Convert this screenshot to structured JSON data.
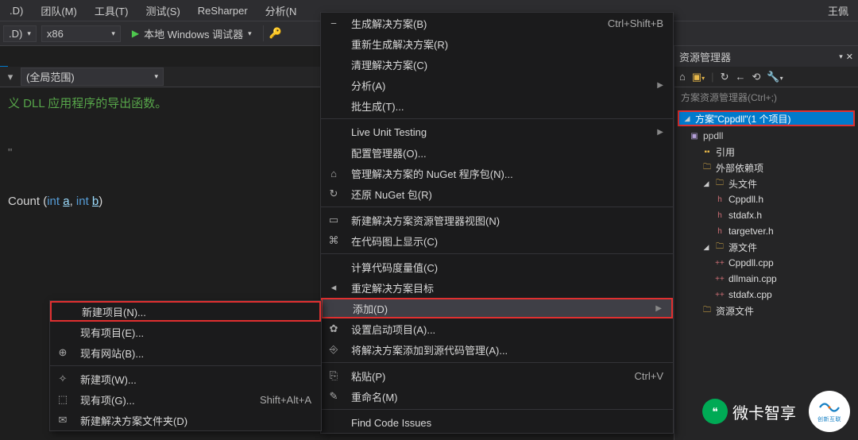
{
  "menubar": {
    "items": [
      ".D)",
      "团队(M)",
      "工具(T)",
      "测试(S)",
      "ReSharper",
      "分析(N"
    ],
    "user": "王佩"
  },
  "toolbar": {
    "platform": ".D)",
    "arch": "x86",
    "debugger": "本地 Windows 调试器"
  },
  "scope": {
    "label": "(全局范围)"
  },
  "code": {
    "comment": "义 DLL 应用程序的导出函数。",
    "quote": "\"",
    "func": {
      "name": "Count",
      "type": "int",
      "p1": "a",
      "p2": "b"
    }
  },
  "mainmenu": {
    "items": [
      {
        "ico": "⎯",
        "t": "生成解决方案(B)",
        "sc": "Ctrl+Shift+B"
      },
      {
        "ico": "",
        "t": "重新生成解决方案(R)",
        "sc": ""
      },
      {
        "ico": "",
        "t": "清理解决方案(C)",
        "sc": ""
      },
      {
        "ico": "",
        "t": "分析(A)",
        "sub": true,
        "sc": ""
      },
      {
        "ico": "",
        "t": "批生成(T)...",
        "sc": ""
      },
      {
        "sep": true
      },
      {
        "ico": "",
        "t": "Live Unit Testing",
        "sub": true,
        "sc": ""
      },
      {
        "ico": "",
        "t": "配置管理器(O)...",
        "sc": ""
      },
      {
        "ico": "⌂",
        "t": "管理解决方案的 NuGet 程序包(N)...",
        "sc": ""
      },
      {
        "ico": "↻",
        "t": "还原 NuGet 包(R)",
        "sc": ""
      },
      {
        "sep": true
      },
      {
        "ico": "▭",
        "t": "新建解决方案资源管理器视图(N)",
        "sc": ""
      },
      {
        "ico": "⌘",
        "t": "在代码图上显示(C)",
        "sc": ""
      },
      {
        "sep": true
      },
      {
        "ico": "",
        "t": "计算代码度量值(C)",
        "sc": ""
      },
      {
        "ico": "◂",
        "t": "重定解决方案目标",
        "sc": ""
      },
      {
        "ico": "",
        "t": "添加(D)",
        "sub": true,
        "sc": "",
        "hl": true,
        "red": true
      },
      {
        "ico": "✿",
        "t": "设置启动项目(A)...",
        "sc": ""
      },
      {
        "ico": "⎆",
        "t": "将解决方案添加到源代码管理(A)...",
        "sc": ""
      },
      {
        "sep": true
      },
      {
        "ico": "⎘",
        "t": "粘贴(P)",
        "sc": "Ctrl+V"
      },
      {
        "ico": "✎",
        "t": "重命名(M)",
        "sc": ""
      },
      {
        "sep": true
      },
      {
        "ico": "",
        "t": "Find Code Issues",
        "sc": ""
      }
    ]
  },
  "submenu": {
    "items": [
      {
        "ico": "",
        "t": "新建项目(N)...",
        "red": true
      },
      {
        "ico": "",
        "t": "现有项目(E)...",
        "sc": ""
      },
      {
        "ico": "⊕",
        "t": "现有网站(B)...",
        "sc": ""
      },
      {
        "sep": true
      },
      {
        "ico": "✧",
        "t": "新建项(W)...",
        "sc": ""
      },
      {
        "ico": "⬚",
        "t": "现有项(G)...",
        "sc": "Shift+Alt+A"
      },
      {
        "ico": "✉",
        "t": "新建解决方案文件夹(D)",
        "sc": ""
      }
    ]
  },
  "side": {
    "title": "资源管理器",
    "search": "方案资源管理器(Ctrl+;)",
    "sln": "方案\"Cppdll\"(1 个项目)",
    "proj": "ppdll",
    "refs": "引用",
    "ext": "外部依赖项",
    "hdrFolder": "头文件",
    "headers": [
      "Cppdll.h",
      "stdafx.h",
      "targetver.h"
    ],
    "srcFolder": "源文件",
    "sources": [
      "Cppdll.cpp",
      "dllmain.cpp",
      "stdafx.cpp"
    ],
    "resFolder": "资源文件"
  },
  "wx": "微卡智享",
  "cx": "创新互联"
}
